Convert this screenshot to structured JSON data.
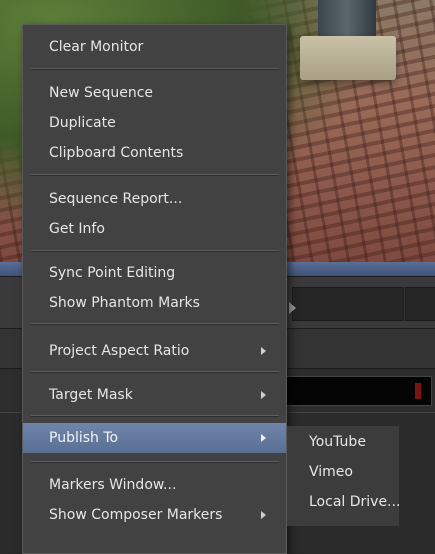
{
  "menu": {
    "items": [
      {
        "label": "Clear Monitor"
      },
      {
        "label": "New Sequence"
      },
      {
        "label": "Duplicate"
      },
      {
        "label": "Clipboard Contents"
      },
      {
        "label": "Sequence Report..."
      },
      {
        "label": "Get Info"
      },
      {
        "label": "Sync Point Editing"
      },
      {
        "label": "Show Phantom Marks"
      },
      {
        "label": "Project Aspect Ratio",
        "submenu": true
      },
      {
        "label": "Target Mask",
        "submenu": true
      },
      {
        "label": "Publish To",
        "submenu": true,
        "highlighted": true
      },
      {
        "label": "Markers Window..."
      },
      {
        "label": "Show Composer Markers",
        "submenu": true
      }
    ]
  },
  "submenu": {
    "parent": "Publish To",
    "items": [
      {
        "label": "YouTube"
      },
      {
        "label": "Vimeo"
      },
      {
        "label": "Local Drive..."
      }
    ]
  },
  "colors": {
    "menu_bg": "#424242",
    "highlight": "#6079a0",
    "text": "#e6e6e6"
  }
}
